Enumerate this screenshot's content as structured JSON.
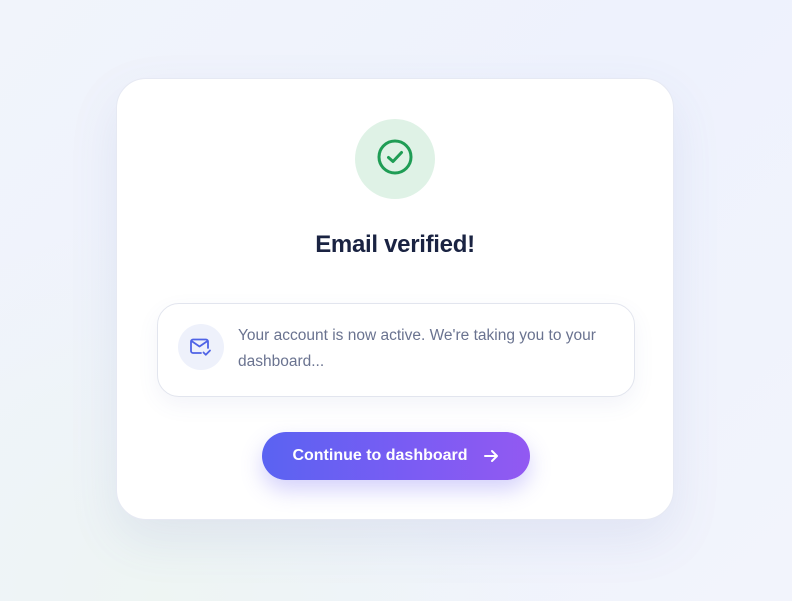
{
  "status": {
    "icon": "check-circle-icon",
    "title": "Email verified!",
    "color_success": "#1f9d55",
    "badge_bg": "#dff2e6"
  },
  "notice": {
    "icon": "mail-check-icon",
    "message": "Your account is now active. We're taking you to your dashboard..."
  },
  "cta": {
    "label": "Continue to dashboard",
    "icon": "arrow-right-icon",
    "gradient_start": "#5a63f2",
    "gradient_end": "#9259f2"
  }
}
